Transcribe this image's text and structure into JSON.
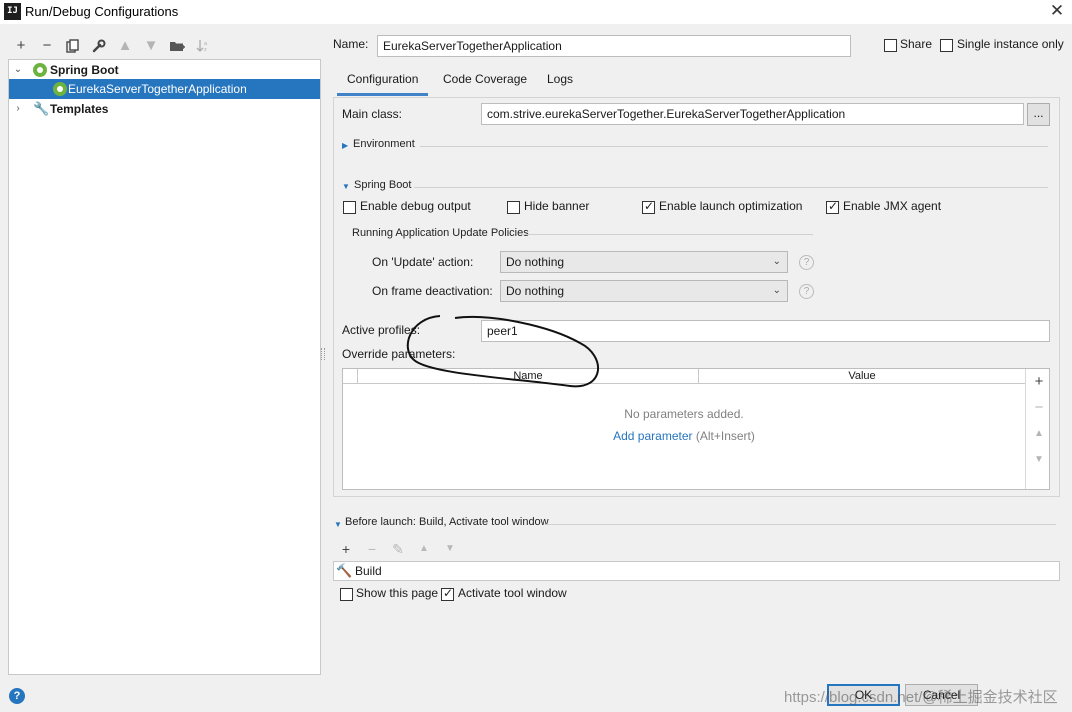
{
  "window": {
    "title": "Run/Debug Configurations",
    "app_icon_text": "IJ"
  },
  "toolbar": {
    "icons": [
      "add-icon",
      "remove-icon",
      "copy-icon",
      "wrench-icon",
      "move-up-icon",
      "move-down-icon",
      "new-folder-icon",
      "sort-icon"
    ]
  },
  "tree": {
    "spring_boot": "Spring Boot",
    "app_config": "EurekaServerTogetherApplication",
    "templates": "Templates"
  },
  "header": {
    "name_label": "Name:",
    "name_value": "EurekaServerTogetherApplication",
    "share_label": "Share",
    "share_checked": false,
    "single_instance_label": "Single instance only",
    "single_instance_checked": false
  },
  "tabs": [
    "Configuration",
    "Code Coverage",
    "Logs"
  ],
  "config": {
    "main_class_label": "Main class:",
    "main_class_value": "com.strive.eurekaServerTogether.EurekaServerTogetherApplication",
    "browse_label": "...",
    "environment_label": "Environment",
    "spring_boot_section": "Spring Boot",
    "enable_debug_output": {
      "label": "Enable debug output",
      "checked": false
    },
    "hide_banner": {
      "label": "Hide banner",
      "checked": false
    },
    "enable_launch_optimization": {
      "label": "Enable launch optimization",
      "checked": true
    },
    "enable_jmx_agent": {
      "label": "Enable JMX agent",
      "checked": true
    },
    "policies_title": "Running Application Update Policies",
    "on_update_label": "On 'Update' action:",
    "on_update_value": "Do nothing",
    "on_frame_label": "On frame deactivation:",
    "on_frame_value": "Do nothing",
    "help_glyph": "?",
    "active_profiles_label": "Active profiles:",
    "active_profiles_value": "peer1",
    "override_label": "Override parameters:",
    "columns": [
      "Name",
      "Value"
    ],
    "no_params_text": "No parameters added.",
    "add_param_link": "Add parameter",
    "add_param_shortcut": "(Alt+Insert)"
  },
  "before_launch": {
    "title": "Before launch: Build, Activate tool window",
    "item": "Build",
    "show_this_page": {
      "label": "Show this page",
      "checked": false
    },
    "activate_tool_window": {
      "label": "Activate tool window",
      "checked": true
    }
  },
  "buttons": {
    "ok": "OK",
    "cancel": "Cancel"
  },
  "watermark": "https://blog.csdn.net/@稀土掘金技术社区",
  "colors": {
    "selection": "#2675bf",
    "link": "#2675bf",
    "spring_green": "#6db33f"
  }
}
